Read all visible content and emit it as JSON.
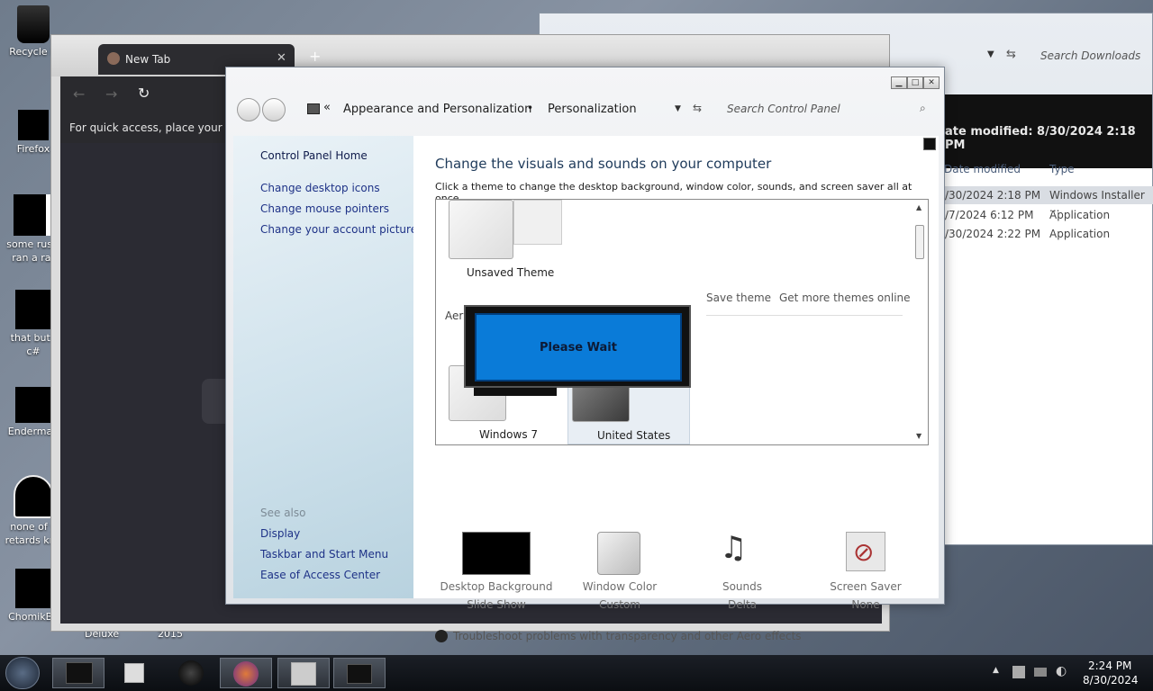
{
  "desktop": {
    "icons": [
      {
        "label": "Recycle B"
      },
      {
        "label": "Firefox"
      },
      {
        "label": "some russi ran a rat"
      },
      {
        "label": "that but i c#"
      },
      {
        "label": "Enderman"
      },
      {
        "label": "none of y retards kno"
      },
      {
        "label": "ChomikBo"
      }
    ],
    "bottom_labels": [
      "Deluxe",
      "2015"
    ]
  },
  "explorer": {
    "search_placeholder": "Search Downloads",
    "date_modified_header": "ate modified: 8/30/2024 2:18 PM",
    "columns": [
      "Date modified",
      "Type"
    ],
    "rows": [
      {
        "date": "/30/2024 2:18 PM",
        "type": "Windows Installer ..."
      },
      {
        "date": "/7/2024 6:12 PM",
        "type": "Application"
      },
      {
        "date": "/30/2024 2:22 PM",
        "type": "Application"
      }
    ]
  },
  "browser": {
    "tab_title": "New Tab",
    "new_tab_symbol": "+",
    "bookmarks_hint": "For quick access, place your book"
  },
  "control_panel": {
    "breadcrumb": [
      "Appearance and Personalization",
      "Personalization"
    ],
    "search_placeholder": "Search Control Panel",
    "sidebar": {
      "home": "Control Panel Home",
      "links": [
        "Change desktop icons",
        "Change mouse pointers",
        "Change your account picture"
      ],
      "see_also_title": "See also",
      "see_also": [
        "Display",
        "Taskbar and Start Menu",
        "Ease of Access Center"
      ]
    },
    "main": {
      "heading": "Change the visuals and sounds on your computer",
      "subtitle": "Click a theme to change the desktop background, window color, sounds, and screen saver all at once.",
      "unsaved_theme": "Unsaved Theme",
      "save_theme": "Save theme",
      "get_more_themes": "Get more themes online",
      "aero_label": "Aer",
      "themes": [
        "Windows 7",
        "United States"
      ],
      "dialog_text": "Please Wait",
      "settings": [
        {
          "title": "Desktop Background",
          "value": "Slide Show"
        },
        {
          "title": "Window Color",
          "value": "Custom"
        },
        {
          "title": "Sounds",
          "value": "Delta"
        },
        {
          "title": "Screen Saver",
          "value": "None"
        }
      ],
      "troubleshoot": "Troubleshoot problems with transparency and other Aero effects"
    }
  },
  "taskbar": {
    "time": "2:24 PM",
    "date": "8/30/2024"
  },
  "colors": {
    "link": "#1e3287",
    "please_wait_bg": "#0a7bd8"
  }
}
